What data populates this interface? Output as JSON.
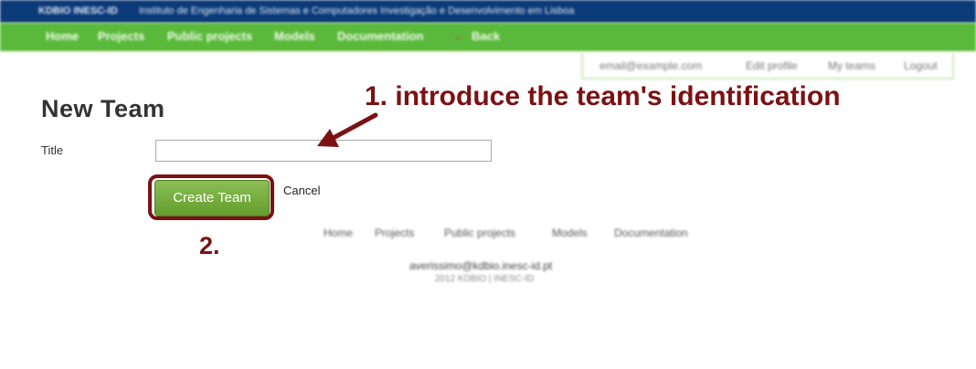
{
  "topbar": {
    "brand": "KDBIO INESC-ID",
    "institution": "Instituto de Engenharia de Sistemas e Computadores Investigação e Desenvolvimento em Lisboa"
  },
  "nav": {
    "items": [
      "Home",
      "Projects",
      "Public projects",
      "Models",
      "Documentation"
    ],
    "back_label": "Back",
    "back_icon": "left-arrow-icon"
  },
  "userbar": {
    "email": "email@example.com",
    "edit_profile": "Edit profile",
    "my_teams": "My teams",
    "logout": "Logout"
  },
  "form": {
    "page_title": "New Team",
    "title_label": "Title",
    "title_value": "",
    "create_label": "Create Team",
    "cancel_label": "Cancel"
  },
  "annotations": {
    "step1": "1. introduce the team's identification",
    "step2": "2.",
    "color": "#7b1113"
  },
  "footer": {
    "nav": [
      "Home",
      "Projects",
      "Public projects",
      "Models",
      "Documentation"
    ],
    "email": "averissimo@kdbio.inesc-id.pt",
    "copyright": "2012 KDBIO | INESC-ID"
  },
  "colors": {
    "topbar": "#0b3a78",
    "navbar": "#5ab93a",
    "button": "#76ac3f"
  }
}
